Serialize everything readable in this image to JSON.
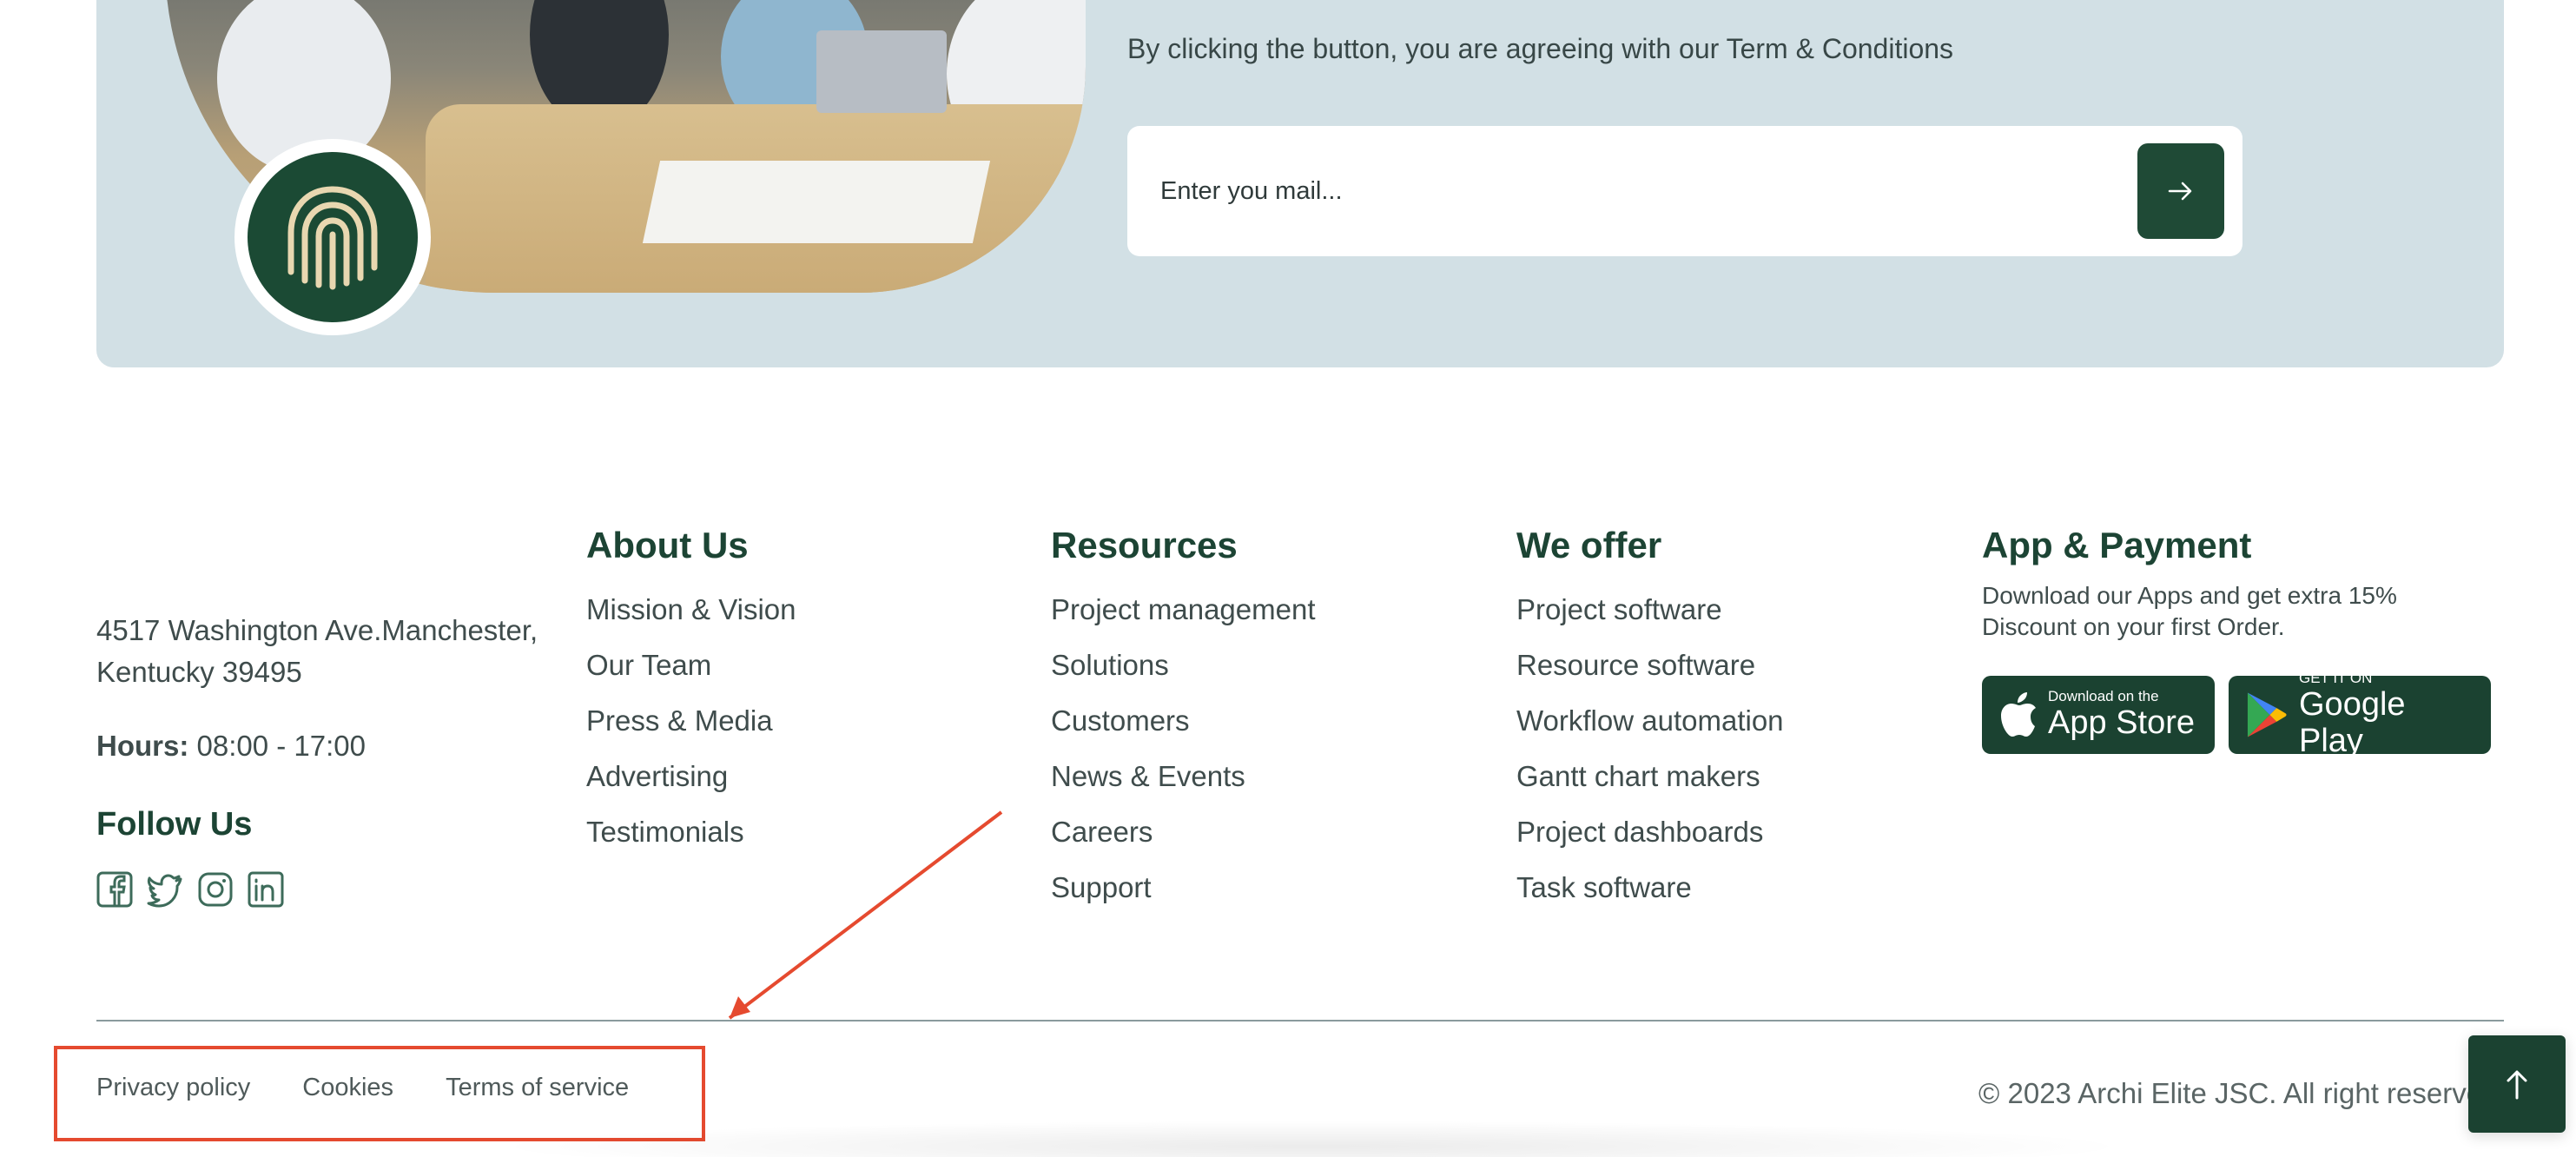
{
  "newsletter": {
    "terms_note": "By clicking the button, you are agreeing with our Term & Conditions",
    "email_placeholder": "Enter you mail...",
    "submit_icon": "arrow-right-icon"
  },
  "contact": {
    "address_line1": "4517 Washington Ave.Manchester,",
    "address_line2": "Kentucky 39495",
    "hours_label": "Hours:",
    "hours_value": "08:00 - 17:00",
    "follow_title": "Follow Us",
    "social_icons": [
      "facebook-icon",
      "twitter-icon",
      "instagram-icon",
      "linkedin-icon"
    ]
  },
  "about": {
    "title": "About Us",
    "items": [
      "Mission & Vision",
      "Our Team",
      "Press & Media",
      "Advertising",
      "Testimonials"
    ]
  },
  "resources": {
    "title": "Resources",
    "items": [
      "Project management",
      "Solutions",
      "Customers",
      "News & Events",
      "Careers",
      "Support"
    ]
  },
  "offer": {
    "title": "We offer",
    "items": [
      "Project software",
      "Resource software",
      "Workflow automation",
      "Gantt chart makers",
      "Project dashboards",
      "Task software"
    ]
  },
  "app": {
    "title": "App & Payment",
    "description": "Download our Apps and get extra 15% Discount on your first Order.",
    "appstore_small": "Download on the",
    "appstore_big": "App Store",
    "googleplay_small": "GET IT ON",
    "googleplay_big": "Google Play"
  },
  "legal": {
    "privacy": "Privacy policy",
    "cookies": "Cookies",
    "terms": "Terms of service"
  },
  "copyright": "© 2023 Archi Elite JSC. All right reserve",
  "colors": {
    "brand_green": "#1b4231",
    "newsletter_bg": "#d2e0e5",
    "annotation_red": "#e54a2f"
  }
}
